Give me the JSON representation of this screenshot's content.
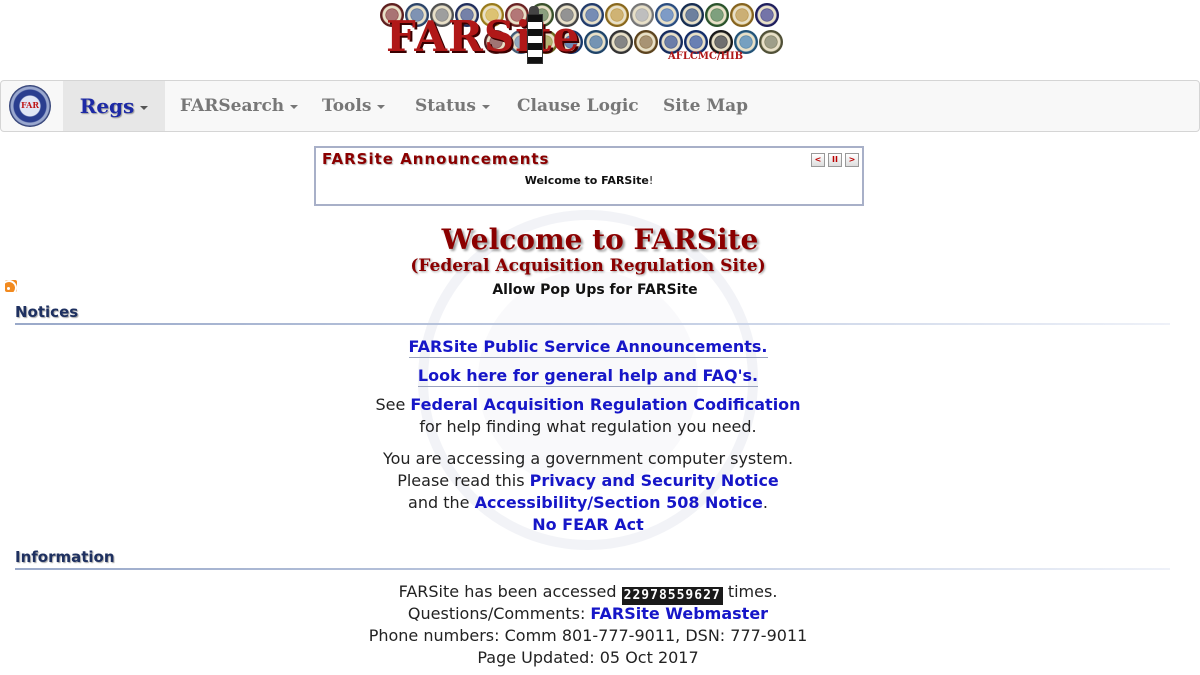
{
  "banner": {
    "logo_text": "FARSite",
    "subtitle": "AFLCMC/HIB",
    "seal_colors": [
      "#7b2a2a",
      "#3b5a8a",
      "#6b6b6b",
      "#2c3e7a",
      "#c9a227",
      "#8a2f2f",
      "#4d6b3a",
      "#5a5a5a",
      "#2e4f8c",
      "#b58a2a",
      "#9c9c9c",
      "#3a66a8",
      "#1f3d6b",
      "#3a6e3a",
      "#b0842b",
      "#2a2a7a",
      "#6e2a2a",
      "#5a7a9a",
      "#8a8a2a",
      "#1f4a8c",
      "#2a5a8a",
      "#444444",
      "#7a5a2a",
      "#1e3a7a",
      "#1a3c8a",
      "#222222",
      "#2f6e9e",
      "#6b6b4a"
    ]
  },
  "nav": {
    "logo_text": "FAR",
    "items": [
      {
        "label": "Regs",
        "dropdown": true,
        "active": true
      },
      {
        "label": "FARSearch",
        "dropdown": true
      },
      {
        "label": "Tools",
        "dropdown": true
      },
      {
        "label": "Status",
        "dropdown": true
      },
      {
        "label": "Clause Logic",
        "dropdown": false
      },
      {
        "label": "Site Map",
        "dropdown": false
      }
    ]
  },
  "announcements": {
    "title": "FARSite Announcements",
    "text_bold": "Welcome to FARSite",
    "text_tail": "!",
    "controls": [
      "prev-icon",
      "pause-icon",
      "next-icon"
    ]
  },
  "welcome": {
    "title": "Welcome to FARSite",
    "subtitle": "(Federal Acquisition Regulation Site)",
    "popups": "Allow Pop Ups for FARSite"
  },
  "notices": {
    "heading": "Notices",
    "psa_link": "FARSite Public Service Announcements.",
    "help_link": "Look here for general help and FAQ's.",
    "see_prefix": "See",
    "codification_link": "Federal Acquisition Regulation Codification",
    "codification_suffix": "for help finding what regulation you need.",
    "gov_line": "You are accessing a government computer system.",
    "read_prefix": "Please read this",
    "privacy_link": "Privacy and Security Notice",
    "and_prefix": "and the",
    "accessibility_link": "Accessibility/Section 508 Notice",
    "accessibility_suffix": ".",
    "nofear_link": "No FEAR Act"
  },
  "information": {
    "heading": "Information",
    "accessed_prefix": "FARSite has been accessed",
    "counter": "22978559627",
    "accessed_suffix": "times.",
    "questions_prefix": "Questions/Comments:",
    "webmaster_link": "FARSite Webmaster",
    "phone": "Phone numbers: Comm 801-777-9011, DSN: 777-9011",
    "updated": "Page Updated: 05 Oct 2017"
  }
}
